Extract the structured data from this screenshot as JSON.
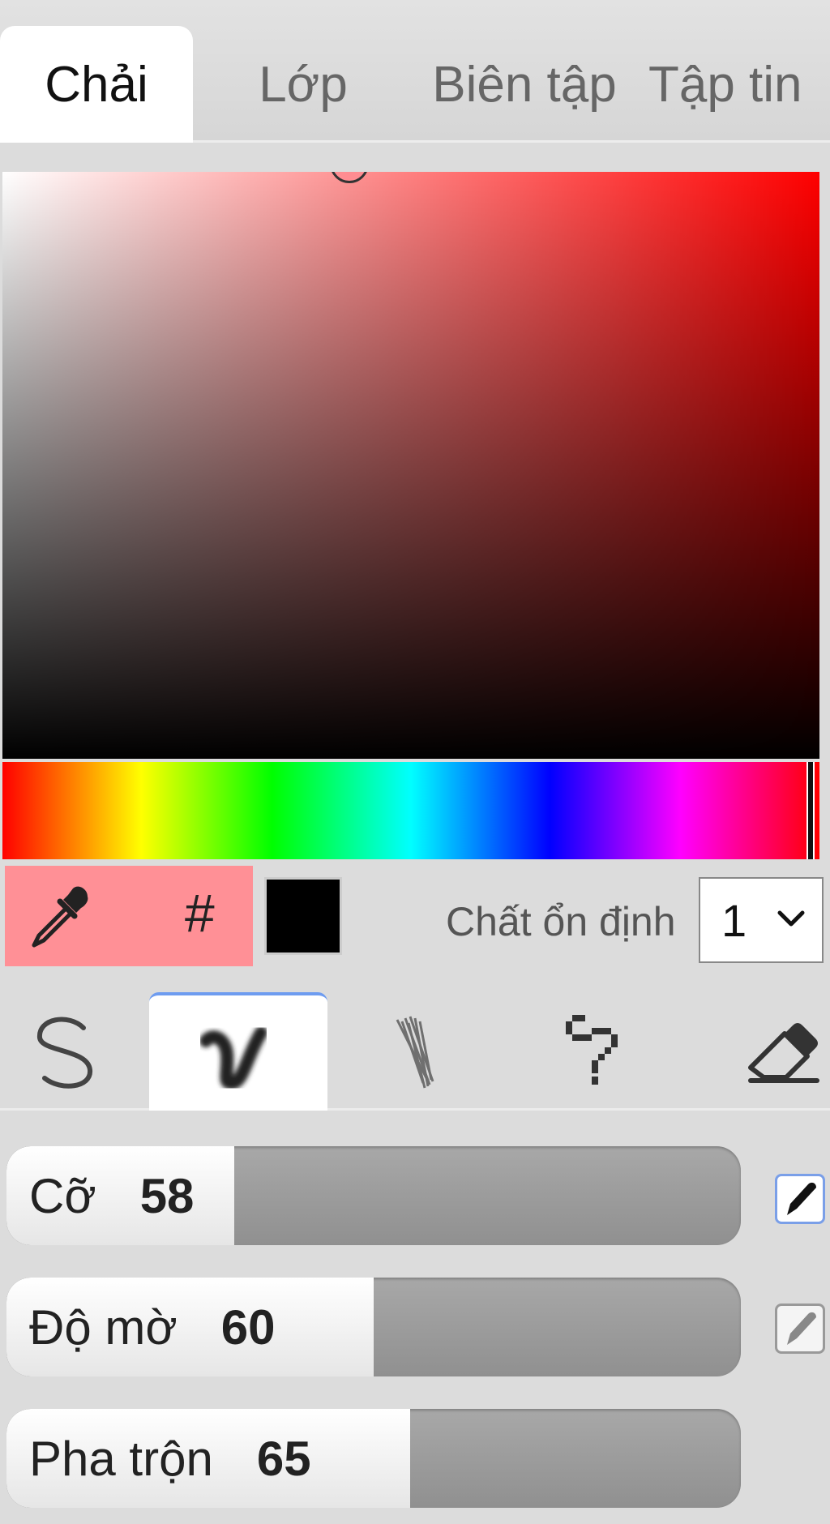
{
  "tabs": [
    {
      "label": "Chải",
      "active": true
    },
    {
      "label": "Lớp",
      "active": false
    },
    {
      "label": "Biên tập",
      "active": false
    },
    {
      "label": "Tập tin",
      "active": false
    }
  ],
  "color": {
    "hue_hex": "#ff0000",
    "current_hex": "#ff9096",
    "secondary_hex": "#000000",
    "hash_symbol": "#",
    "hue_position": 0.99
  },
  "stabilizer": {
    "label": "Chất ổn định",
    "value": "1"
  },
  "brush_tools": [
    {
      "name": "pen-tool-icon",
      "active": false
    },
    {
      "name": "blend-brush-icon",
      "active": true
    },
    {
      "name": "sketchy-brush-icon",
      "active": false
    },
    {
      "name": "pixel-brush-icon",
      "active": false
    },
    {
      "name": "eraser-icon",
      "active": false
    }
  ],
  "sliders": {
    "size": {
      "label": "Cỡ",
      "value": "58",
      "fraction": 0.31
    },
    "opacity": {
      "label": "Độ mờ",
      "value": "60",
      "fraction": 0.5
    },
    "mixing": {
      "label": "Pha trộn",
      "value": "65",
      "fraction": 0.55
    }
  },
  "colors": {
    "accent": "#6e9cf0",
    "background": "#dcdcdc"
  }
}
